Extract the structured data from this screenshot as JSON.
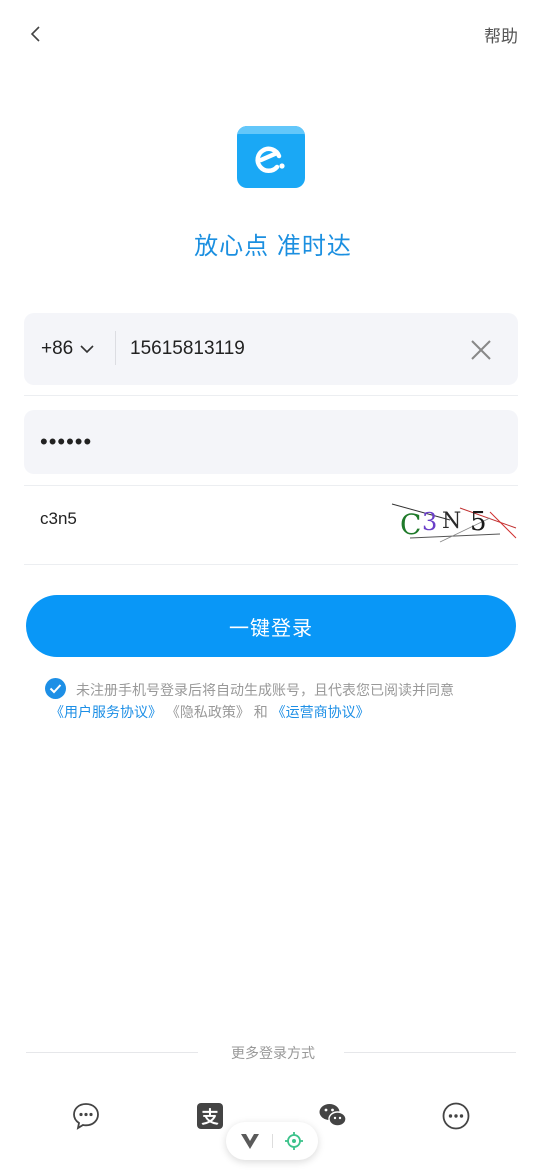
{
  "header": {
    "back_icon": "chevron-left-icon",
    "help_label": "帮助"
  },
  "brand": {
    "logo_icon": "eleme-logo-icon",
    "slogan": "放心点 准时达",
    "color": "#1aa8f5"
  },
  "form": {
    "country_code": "+86",
    "phone_value": "15615813119",
    "clear_icon": "close-icon",
    "password_value": "••••••",
    "captcha_value": "c3n5",
    "captcha_image_text": "C3N5"
  },
  "login_button": {
    "label": "一键登录",
    "color": "#0997f7"
  },
  "agreement": {
    "checked": true,
    "text_line1": "未注册手机号登录后将自动生成账号，且代表您已阅读并同意",
    "link_user": "《用户服务协议》",
    "link_privacy": "《隐私政策》",
    "and_text": "和",
    "link_operator": "《运营商协议》"
  },
  "more_login": {
    "title": "更多登录方式",
    "options": [
      {
        "icon": "chat-bubble-icon"
      },
      {
        "icon": "alipay-icon"
      },
      {
        "icon": "wechat-icon"
      },
      {
        "icon": "more-options-icon"
      }
    ]
  },
  "floating_toolbar": {
    "icons": [
      "vue-devtools-icon",
      "locate-icon"
    ]
  }
}
